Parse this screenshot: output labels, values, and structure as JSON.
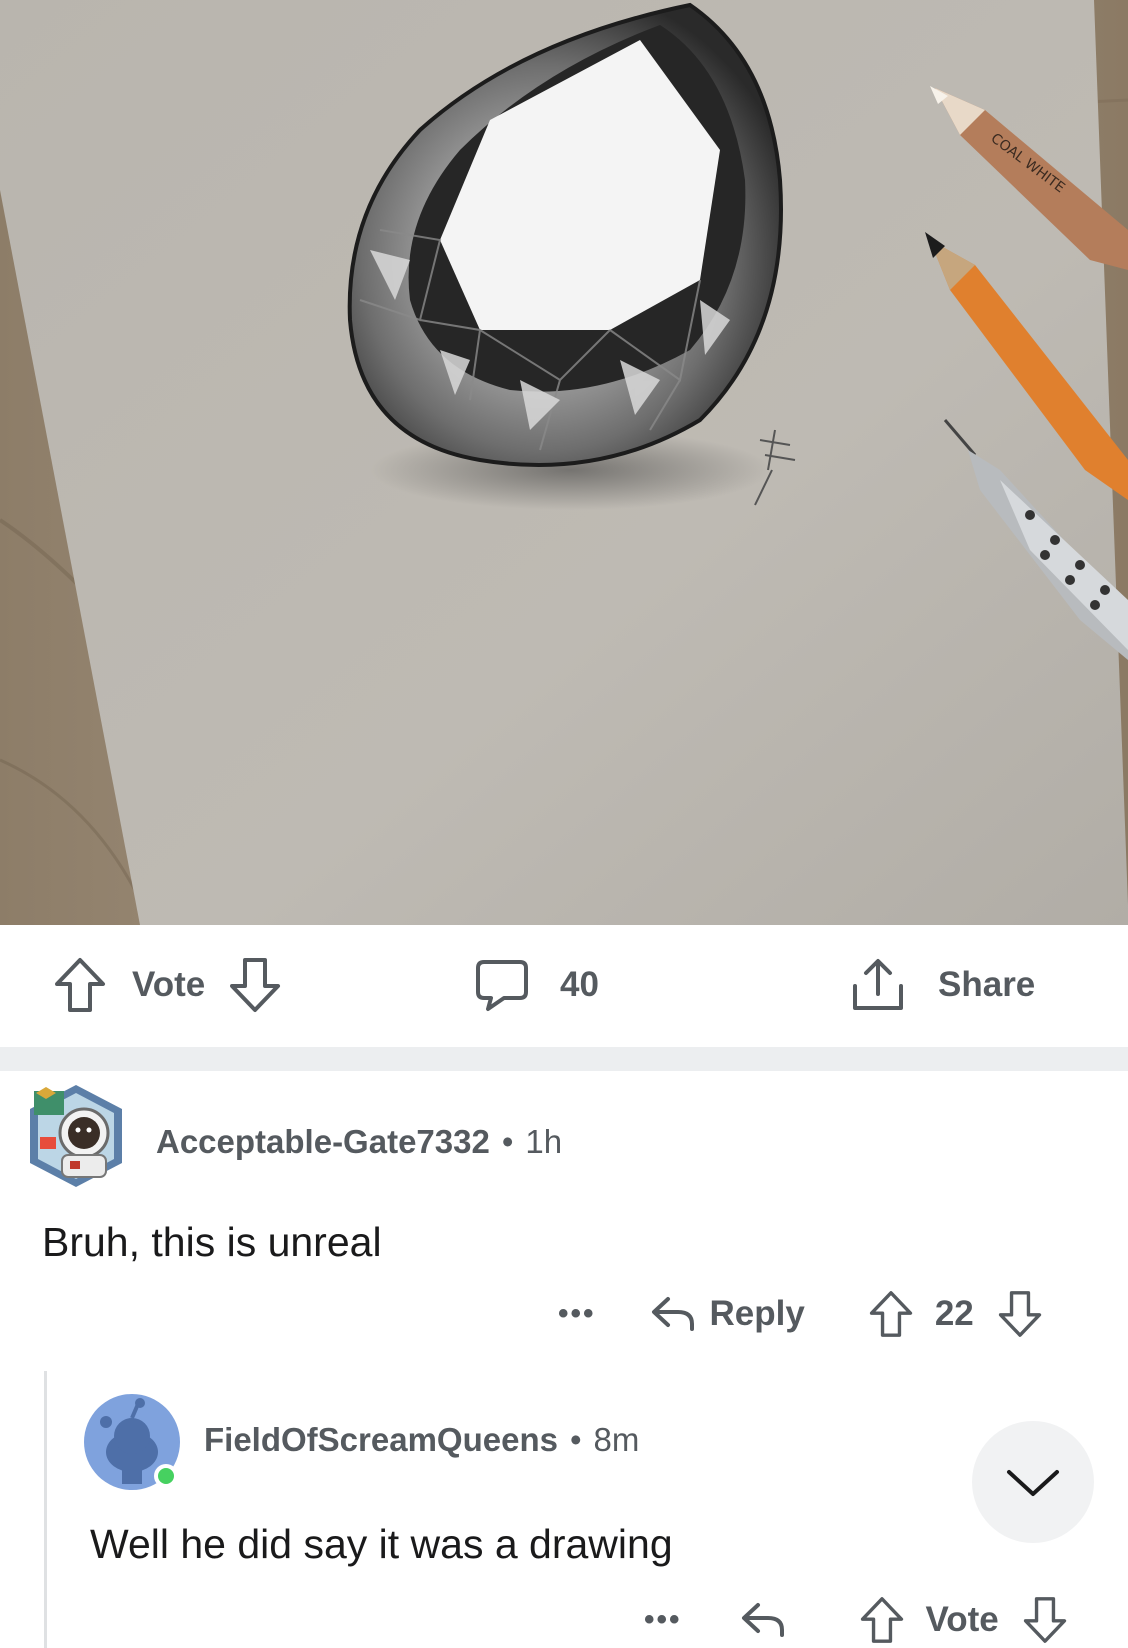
{
  "post": {
    "image_alt": "Pencil drawing of a pear-shaped diamond on grey paper with three pencils",
    "signature_mark": "signature",
    "pencil_label": "COAL WHITE",
    "vote_label": "Vote",
    "comment_count": "40",
    "share_label": "Share"
  },
  "icons": {
    "upvote": "arrow-up-outline-icon",
    "downvote": "arrow-down-outline-icon",
    "comment": "speech-bubble-icon",
    "share": "share-upload-icon",
    "reply": "reply-arrow-icon",
    "collapse": "chevron-down-icon"
  },
  "colors": {
    "meta_text": "#555a5f",
    "body_text": "#1a1a1b",
    "divider": "#eceef0",
    "online_dot": "#46d160",
    "snoo_avatar_bg": "#7fa2dd"
  },
  "comments": [
    {
      "author": "Acceptable-Gate7332",
      "separator": "•",
      "time": "1h",
      "body": "Bruh, this is unreal",
      "more": "•••",
      "reply_label": "Reply",
      "score": "22"
    },
    {
      "author": "FieldOfScreamQueens",
      "separator": "•",
      "time": "8m",
      "body": "Well he did say it was a drawing",
      "more": "•••",
      "vote_label": "Vote"
    }
  ]
}
